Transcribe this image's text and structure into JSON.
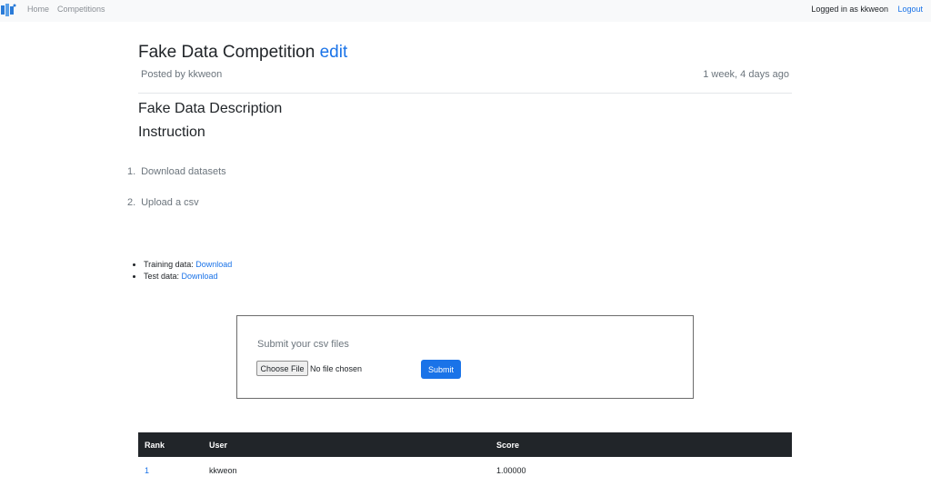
{
  "nav": {
    "brand_icon": "kaggle-style-logo-icon",
    "home": "Home",
    "competitions": "Competitions",
    "logged_in": "Logged in as kkweon",
    "logout": "Logout"
  },
  "competition": {
    "title": "Fake Data Competition",
    "edit_label": "edit",
    "posted_by": "Posted by kkweon",
    "posted_when": "1 week, 4 days ago",
    "description": "Fake Data Description",
    "instruction_heading": "Instruction",
    "steps": [
      {
        "num": "1.",
        "text": "Download datasets"
      },
      {
        "num": "2.",
        "text": "Upload a csv"
      }
    ],
    "downloads": [
      {
        "label": "Training data: ",
        "link": "Download"
      },
      {
        "label": "Test data: ",
        "link": "Download"
      }
    ]
  },
  "submit": {
    "label": "Submit your csv files",
    "choose_file": "Choose File",
    "no_file": "No file chosen",
    "submit_label": "Submit"
  },
  "leaderboard": {
    "headers": [
      "Rank",
      "User",
      "Score"
    ],
    "rows": [
      {
        "rank": "1",
        "user": "kkweon",
        "score": "1.00000"
      }
    ]
  },
  "colors": {
    "accent": "#1a73e8",
    "table_header": "#212529",
    "navbar": "#f8f9fa"
  }
}
